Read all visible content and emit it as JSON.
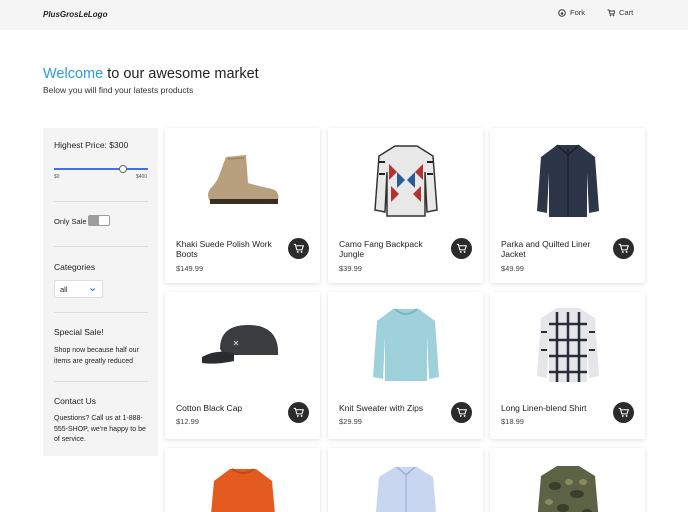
{
  "header": {
    "logo": "PlusGrosLeLogo",
    "fork_label": "Fork",
    "cart_label": "Cart"
  },
  "hero": {
    "title_accent": "Welcome",
    "title_rest": " to our awesome market",
    "subtitle": "Below you will find your latests products"
  },
  "sidebar": {
    "price_label": "Highest Price: $300",
    "price_value": 300,
    "price_min_label": "$0",
    "price_max_label": "$400",
    "only_sale_label": "Only Sale",
    "categories_label": "Categories",
    "category_selected": "all",
    "special_title": "Special Sale!",
    "special_text": "Shop now because half our items are greatly reduced",
    "contact_title": "Contact Us",
    "contact_text": "Questions? Call us at 1-888-555-SHOP, we're happy to be of service."
  },
  "products": [
    {
      "name": "Khaki Suede Polish Work Boots",
      "price": "$149.99",
      "icon": "boot-image"
    },
    {
      "name": "Camo Fang Backpack Jungle",
      "price": "$39.99",
      "icon": "patterned-jacket-image"
    },
    {
      "name": "Parka and Quilted Liner Jacket",
      "price": "$49.99",
      "icon": "navy-jacket-image"
    },
    {
      "name": "Cotton Black Cap",
      "price": "$12.99",
      "icon": "black-cap-image"
    },
    {
      "name": "Knit Sweater with Zips",
      "price": "$29.99",
      "icon": "blue-sweater-image"
    },
    {
      "name": "Long Linen-blend Shirt",
      "price": "$18.99",
      "icon": "plaid-shirt-image"
    },
    {
      "name": "",
      "price": "",
      "icon": "orange-sweater-image"
    },
    {
      "name": "",
      "price": "",
      "icon": "light-blue-shirt-image"
    },
    {
      "name": "",
      "price": "",
      "icon": "camo-jacket-image"
    }
  ],
  "colors": {
    "accent": "#2e9bd6",
    "slider": "#4471e0",
    "cart_button": "#2b2b2b"
  }
}
